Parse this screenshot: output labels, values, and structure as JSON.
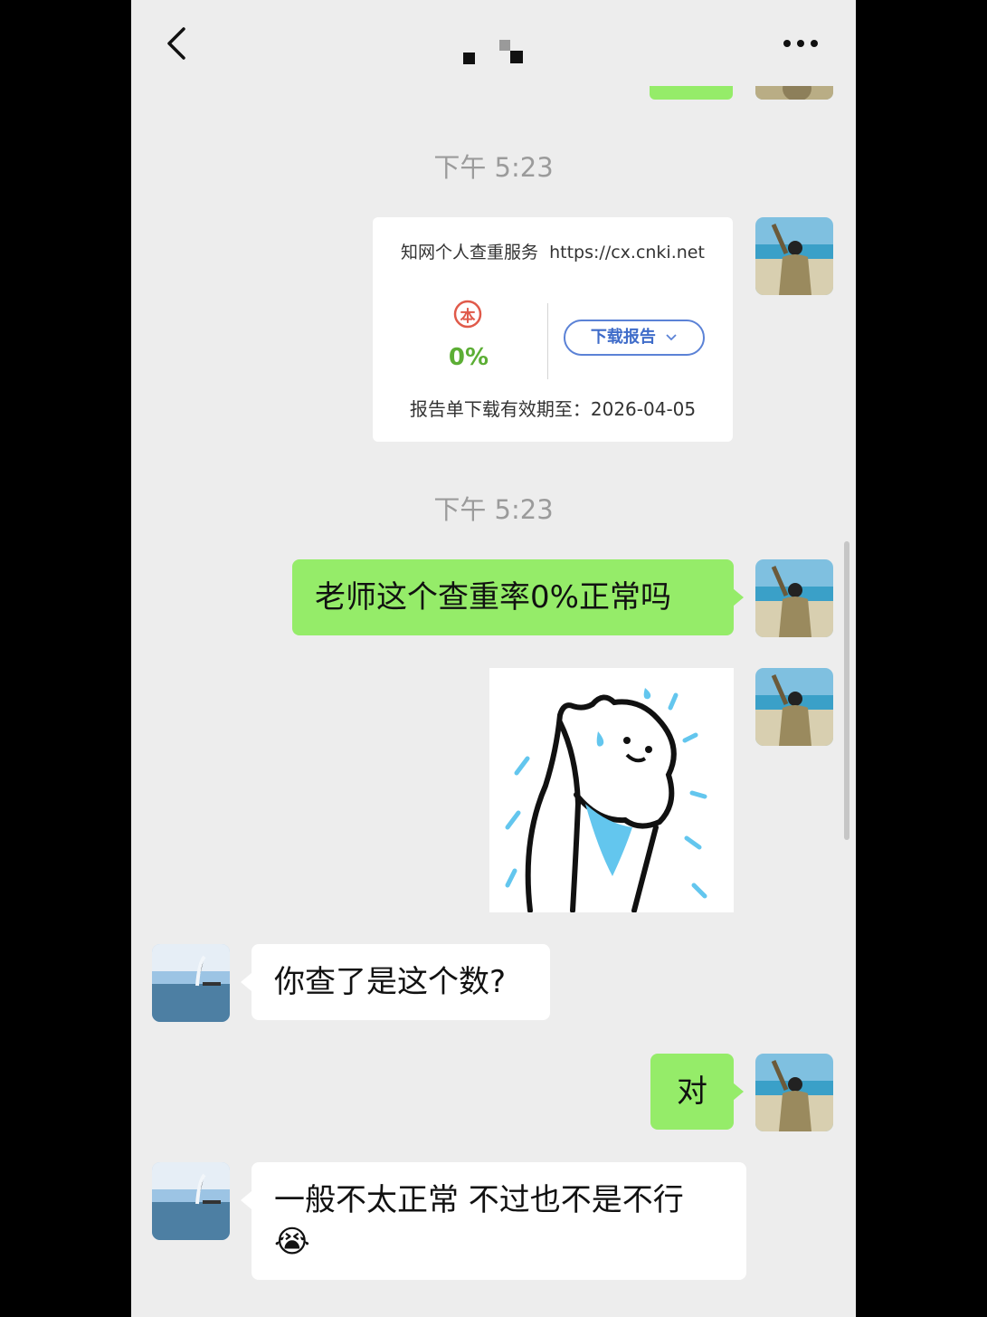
{
  "header": {
    "back_icon": "chevron-left-icon",
    "title_icon": "mosaic-title-icon",
    "more_icon": "more-dots-icon"
  },
  "messages": {
    "time1": "下午 5:23",
    "card": {
      "service": "知网个人查重服务",
      "url": "https://cx.cnki.net",
      "stamp_char": "本",
      "percent": "0%",
      "download_label": "下载报告",
      "expiry": "报告单下载有效期至：2026-04-05"
    },
    "time2": "下午 5:23",
    "msg1": "老师这个查重率0%正常吗",
    "sticker_icon": "sweating-cat-sticker",
    "msg2": "你查了是这个数?",
    "msg3": "对",
    "msg4": "一般不太正常 不过也不是不行",
    "msg4_emoji": "😭"
  },
  "colors": {
    "chat_bg": "#ededed",
    "sent_bubble": "#95ec69",
    "received_bubble": "#ffffff",
    "time_text": "#9b9b9b",
    "percent_green": "#5cae35",
    "button_blue": "#3f6cc9"
  }
}
